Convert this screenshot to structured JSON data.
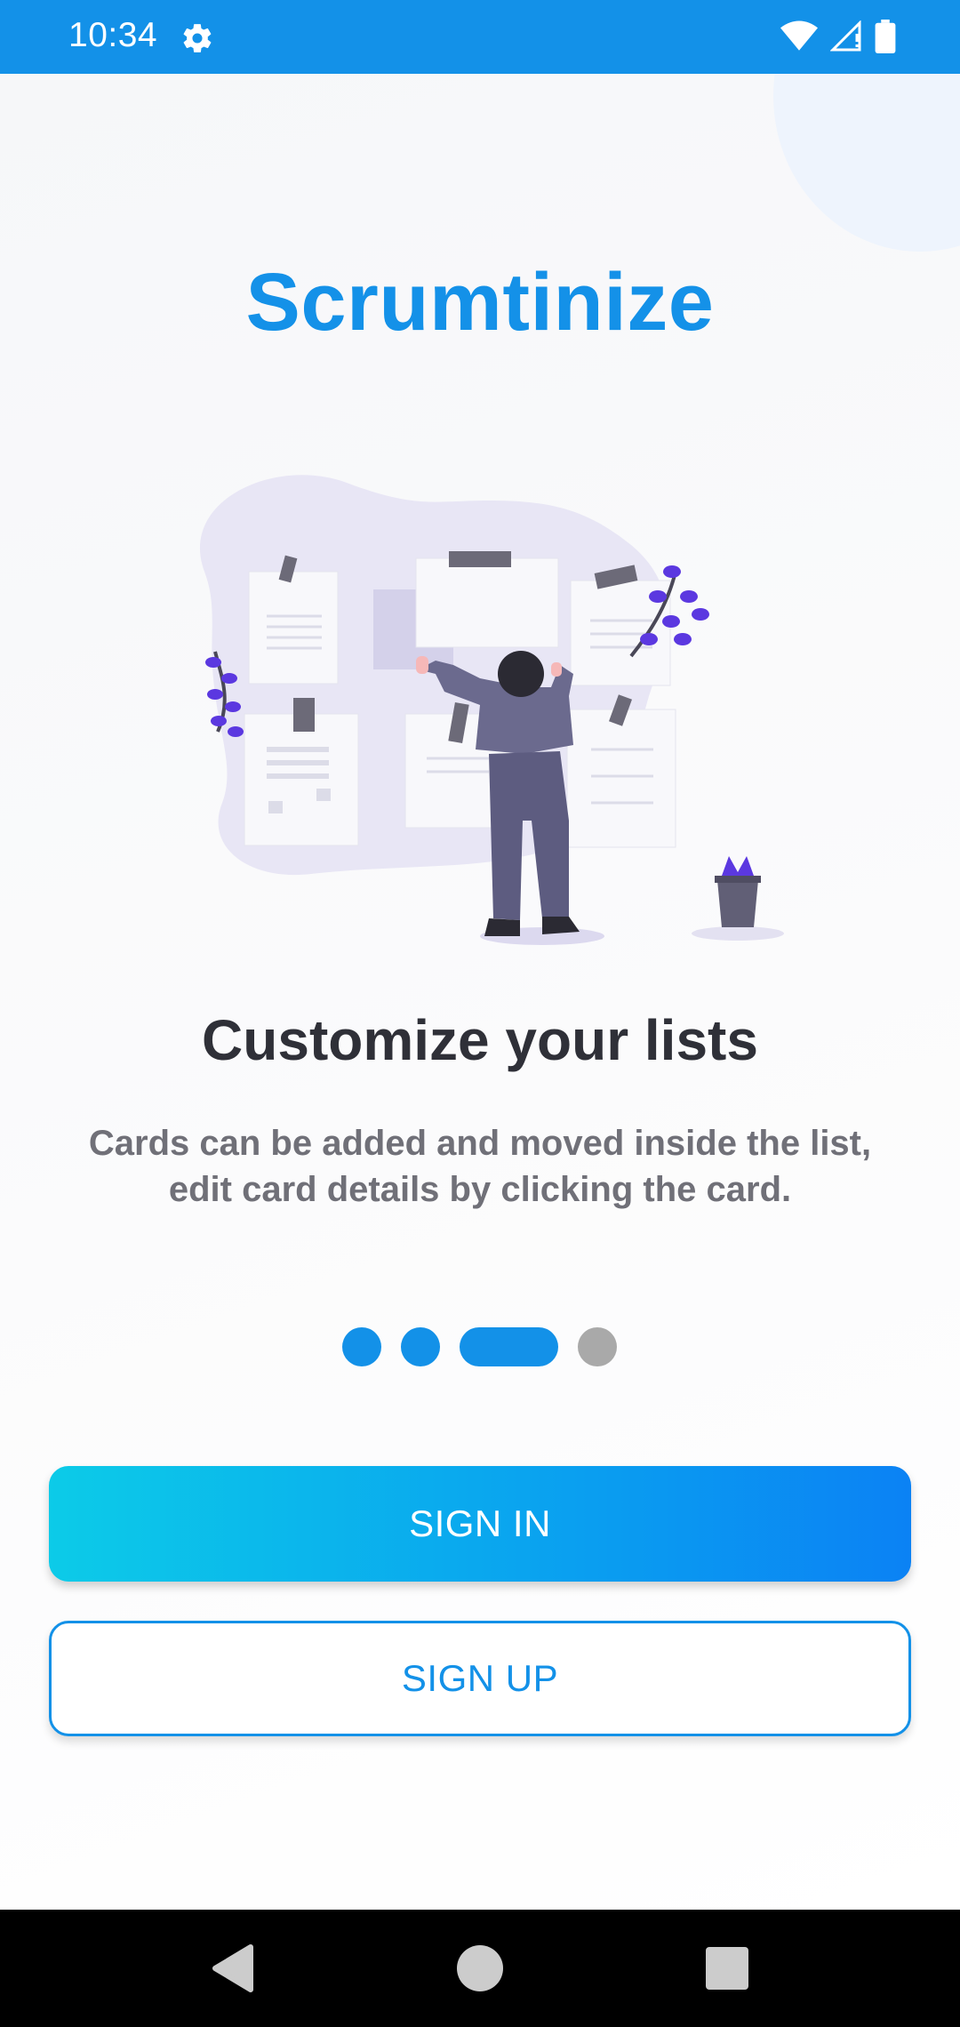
{
  "status_bar": {
    "time": "10:34",
    "icons": [
      "gear-icon",
      "wifi-icon",
      "signal-icon",
      "battery-icon"
    ],
    "background": "#1391e8"
  },
  "app": {
    "title": "Scrumtinize",
    "title_color": "#1491e8"
  },
  "onboarding": {
    "heading": "Customize your lists",
    "description": "Cards can be added and moved inside the list, edit card details by clicking the card.",
    "page_indicator": {
      "total": 4,
      "active_index": 2,
      "active_color": "#1391e8",
      "completed_color": "#1391e8",
      "inactive_color": "#a9a9a9"
    }
  },
  "buttons": {
    "sign_in": "SIGN IN",
    "sign_up": "SIGN UP"
  },
  "nav_bar": {
    "icons": [
      "back-icon",
      "home-icon",
      "recents-icon"
    ]
  }
}
